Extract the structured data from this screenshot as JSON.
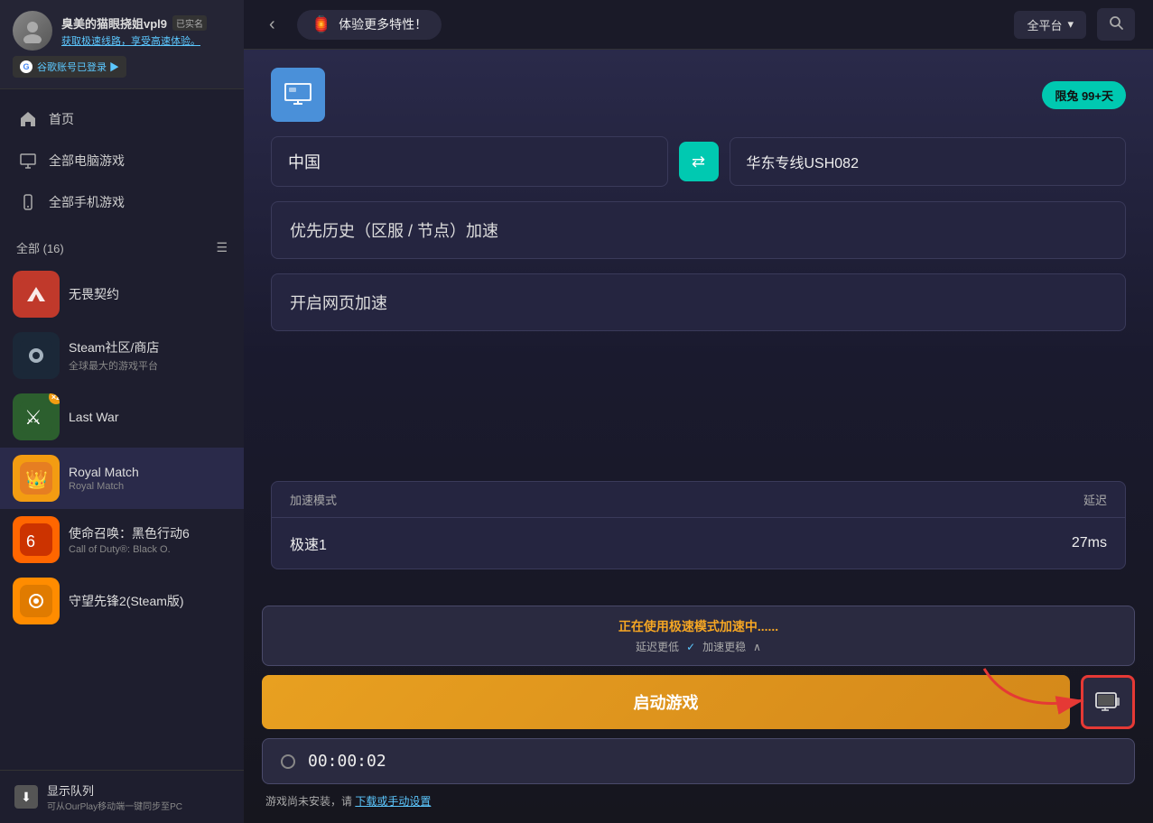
{
  "user": {
    "name": "臭美的猫眼挠姐vpl9",
    "verified": "已实名",
    "promo": "获取极速线路，享受高速体验。",
    "google_login": "谷歌账号已登录 ▶"
  },
  "nav": {
    "home": "首页",
    "pc_games": "全部电脑游戏",
    "mobile_games": "全部手机游戏"
  },
  "game_list": {
    "section_title": "全部 (16)",
    "games": [
      {
        "id": "wuji",
        "title": "无畏契约",
        "subtitle": "",
        "emoji": "🔫",
        "color": "#c0392b"
      },
      {
        "id": "steam",
        "title": "Steam社区/商店",
        "subtitle": "全球最大的游戏平台",
        "emoji": "🎮",
        "color": "#1b2838"
      },
      {
        "id": "lastwar",
        "title": "Last War",
        "subtitle": "",
        "emoji": "⚔️",
        "color": "#2c5f2e"
      },
      {
        "id": "royalmatch",
        "title": "Royal Match",
        "subtitle": "Royal Match",
        "emoji": "👑",
        "color": "#f39c12"
      },
      {
        "id": "cod",
        "title": "使命召唤：黑色行动6",
        "subtitle": "Call of Duty®: Black O.",
        "emoji": "🎯",
        "color": "#ff6600"
      },
      {
        "id": "overwatch",
        "title": "守望先锋2(Steam版)",
        "subtitle": "",
        "emoji": "🦸",
        "color": "#ff8c00"
      }
    ]
  },
  "footer": {
    "title": "显示队列",
    "subtitle": "可从OurPlay移动端一键同步至PC"
  },
  "topbar": {
    "promo": "体验更多特性！",
    "platform": "全平台",
    "chevron": "▾"
  },
  "accelerator": {
    "monitor_icon": "🖥",
    "limit_badge": "限兔  99+天",
    "region_from": "中国",
    "region_to": "华东专线USH082",
    "option1": "优先历史（区服 / 节点）加速",
    "option2": "开启网页加速",
    "speed_table": {
      "col1": "加速模式",
      "col2": "延迟",
      "rows": [
        {
          "mode": "极速1",
          "latency": "27ms"
        }
      ]
    },
    "status_text": "正在使用极速模式加速中......",
    "status_sub1": "延迟更低",
    "status_sub2": "加速更稳",
    "launch_btn": "启动游戏",
    "timer": "00:00:02",
    "install_note": "游戏尚未安装，请",
    "install_link": "下载或手动设置"
  }
}
